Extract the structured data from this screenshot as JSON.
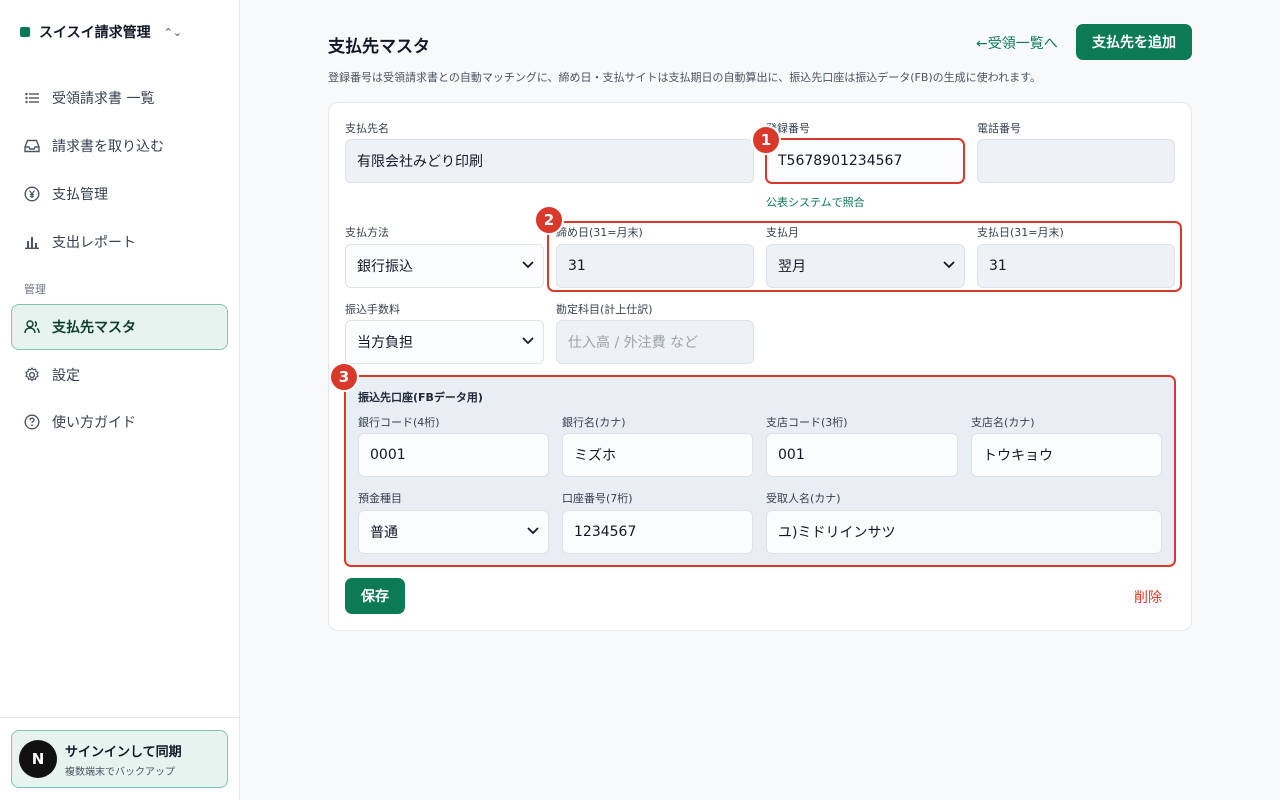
{
  "sidebar": {
    "brand": "スイスイ請求管理",
    "items": [
      {
        "label": "受領請求書 一覧",
        "icon": "list-icon"
      },
      {
        "label": "請求書を取り込む",
        "icon": "inbox-icon"
      },
      {
        "label": "支払管理",
        "icon": "yen-icon"
      },
      {
        "label": "支出レポート",
        "icon": "bar-chart-icon"
      }
    ],
    "section_label": "管理",
    "admin_items": [
      {
        "label": "支払先マスタ",
        "icon": "users-icon",
        "active": true
      },
      {
        "label": "設定",
        "icon": "gear-icon"
      },
      {
        "label": "使い方ガイド",
        "icon": "help-icon"
      }
    ],
    "signin": {
      "avatar": "N",
      "title": "サインインして同期",
      "subtitle": "複数端末でバックアップ"
    }
  },
  "header": {
    "title": "支払先マスタ",
    "back_link": "←受領一覧へ",
    "add_button": "支払先を追加",
    "description": "登録番号は受領請求書との自動マッチングに、締め日・支払サイトは支払期日の自動算出に、振込先口座は振込データ(FB)の生成に使われます。"
  },
  "form": {
    "payee_name": {
      "label": "支払先名",
      "value": "有限会社みどり印刷"
    },
    "registration_number": {
      "label": "登録番号",
      "value": "T5678901234567"
    },
    "phone": {
      "label": "電話番号",
      "value": ""
    },
    "verify_link": "公表システムで照合",
    "payment_method": {
      "label": "支払方法",
      "value": "銀行振込"
    },
    "closing_day": {
      "label": "締め日(31=月末)",
      "value": "31"
    },
    "payment_month": {
      "label": "支払月",
      "value": "翌月"
    },
    "payment_day": {
      "label": "支払日(31=月末)",
      "value": "31"
    },
    "transfer_fee": {
      "label": "振込手数料",
      "value": "当方負担"
    },
    "account_title": {
      "label": "勘定科目(計上仕訳)",
      "placeholder": "仕入高 / 外注費 など"
    },
    "bank": {
      "heading": "振込先口座(FBデータ用)",
      "bank_code": {
        "label": "銀行コード(4桁)",
        "value": "0001"
      },
      "bank_name": {
        "label": "銀行名(カナ)",
        "value": "ミズホ"
      },
      "branch_code": {
        "label": "支店コード(3桁)",
        "value": "001"
      },
      "branch_name": {
        "label": "支店名(カナ)",
        "value": "トウキョウ"
      },
      "account_type": {
        "label": "預金種目",
        "value": "普通"
      },
      "account_number": {
        "label": "口座番号(7桁)",
        "value": "1234567"
      },
      "recipient_name": {
        "label": "受取人名(カナ)",
        "value": "ユ)ミドリインサツ"
      }
    },
    "save_button": "保存",
    "delete_link": "削除"
  },
  "annotations": {
    "markers": [
      "1",
      "2",
      "3"
    ],
    "color": "#d9392b"
  },
  "colors": {
    "accent": "#0b7a55",
    "danger": "#d9392b"
  }
}
